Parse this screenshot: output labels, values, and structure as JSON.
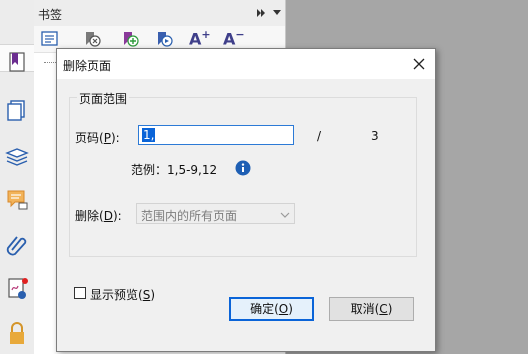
{
  "pane": {
    "title": "书签"
  },
  "dialog": {
    "title": "删除页面",
    "group_label": "页面范围",
    "page_label": "页码(",
    "page_label_key": "P",
    "page_label_end": "):",
    "page_input_value": "1,",
    "separator": "/",
    "total_pages": "3",
    "example_text": "范例：1,5-9,12",
    "delete_label": "删除(",
    "delete_label_key": "D",
    "delete_label_end": "):",
    "delete_option": "范围内的所有页面",
    "preview_label": "显示预览(",
    "preview_label_key": "S",
    "preview_label_end": ")",
    "ok_label": "确定(",
    "ok_key": "O",
    "ok_end": ")",
    "cancel_label": "取消(",
    "cancel_key": "C",
    "cancel_end": ")"
  },
  "toolbar": {
    "text_a_plus": "A",
    "text_a_minus": "A"
  },
  "colors": {
    "accent": "#0a64d8",
    "info_blue": "#1e5fb4"
  }
}
